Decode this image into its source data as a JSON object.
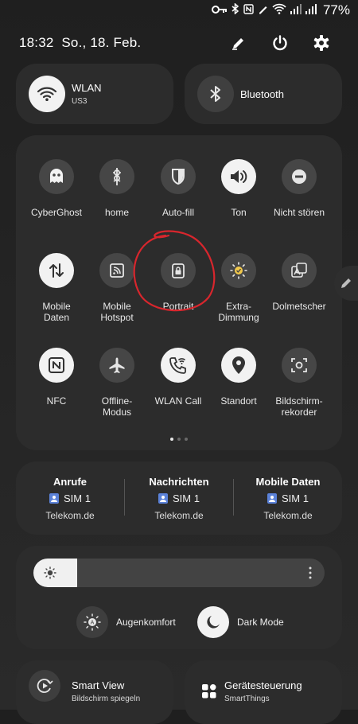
{
  "status_bar": {
    "battery": "77%"
  },
  "header": {
    "datetime": "18:32  So., 18. Feb."
  },
  "wlan": {
    "title": "WLAN",
    "subtitle": "US3"
  },
  "bluetooth": {
    "title": "Bluetooth"
  },
  "tiles": [
    {
      "label": "CyberGhost",
      "icon": "ghost-icon",
      "active": false
    },
    {
      "label": "home",
      "icon": "home-assistant-icon",
      "active": false
    },
    {
      "label": "Auto-fill",
      "icon": "shield-icon",
      "active": false
    },
    {
      "label": "Ton",
      "icon": "speaker-icon",
      "active": true
    },
    {
      "label": "Nicht stören",
      "icon": "minus-circle-icon",
      "active": false
    },
    {
      "label": "Mobile\nDaten",
      "icon": "data-arrows-icon",
      "active": true
    },
    {
      "label": "Mobile\nHotspot",
      "icon": "hotspot-icon",
      "active": false
    },
    {
      "label": "Portrait",
      "icon": "lock-icon",
      "active": false
    },
    {
      "label": "Extra-\nDimmung",
      "icon": "dim-icon",
      "active": false
    },
    {
      "label": "Dolmetscher",
      "icon": "translate-icon",
      "active": false
    },
    {
      "label": "NFC",
      "icon": "nfc-icon",
      "active": true
    },
    {
      "label": "Offline-\nModus",
      "icon": "airplane-icon",
      "active": false
    },
    {
      "label": "WLAN Call",
      "icon": "wifi-call-icon",
      "active": true
    },
    {
      "label": "Standort",
      "icon": "location-icon",
      "active": true
    },
    {
      "label": "Bildschirm-\nrekorder",
      "icon": "screen-recorder-icon",
      "active": false
    }
  ],
  "sim": [
    {
      "title": "Anrufe",
      "sim": "SIM 1",
      "carrier": "Telekom.de"
    },
    {
      "title": "Nachrichten",
      "sim": "SIM 1",
      "carrier": "Telekom.de"
    },
    {
      "title": "Mobile Daten",
      "sim": "SIM 1",
      "carrier": "Telekom.de"
    }
  ],
  "brightness": {
    "level": 0.15
  },
  "toggles": [
    {
      "label": "Augenkomfort",
      "icon": "eye-comfort-icon",
      "active": false
    },
    {
      "label": "Dark Mode",
      "icon": "moon-icon",
      "active": true
    }
  ],
  "bottom": [
    {
      "title": "Smart View",
      "subtitle": "Bildschirm spiegeln",
      "icon": "smart-view-icon"
    },
    {
      "title": "Gerätesteuerung",
      "subtitle": "SmartThings",
      "icon": "grid-icon"
    }
  ],
  "colors": {
    "annotation": "#d8262d",
    "sim_badge": "#5b82d9"
  }
}
